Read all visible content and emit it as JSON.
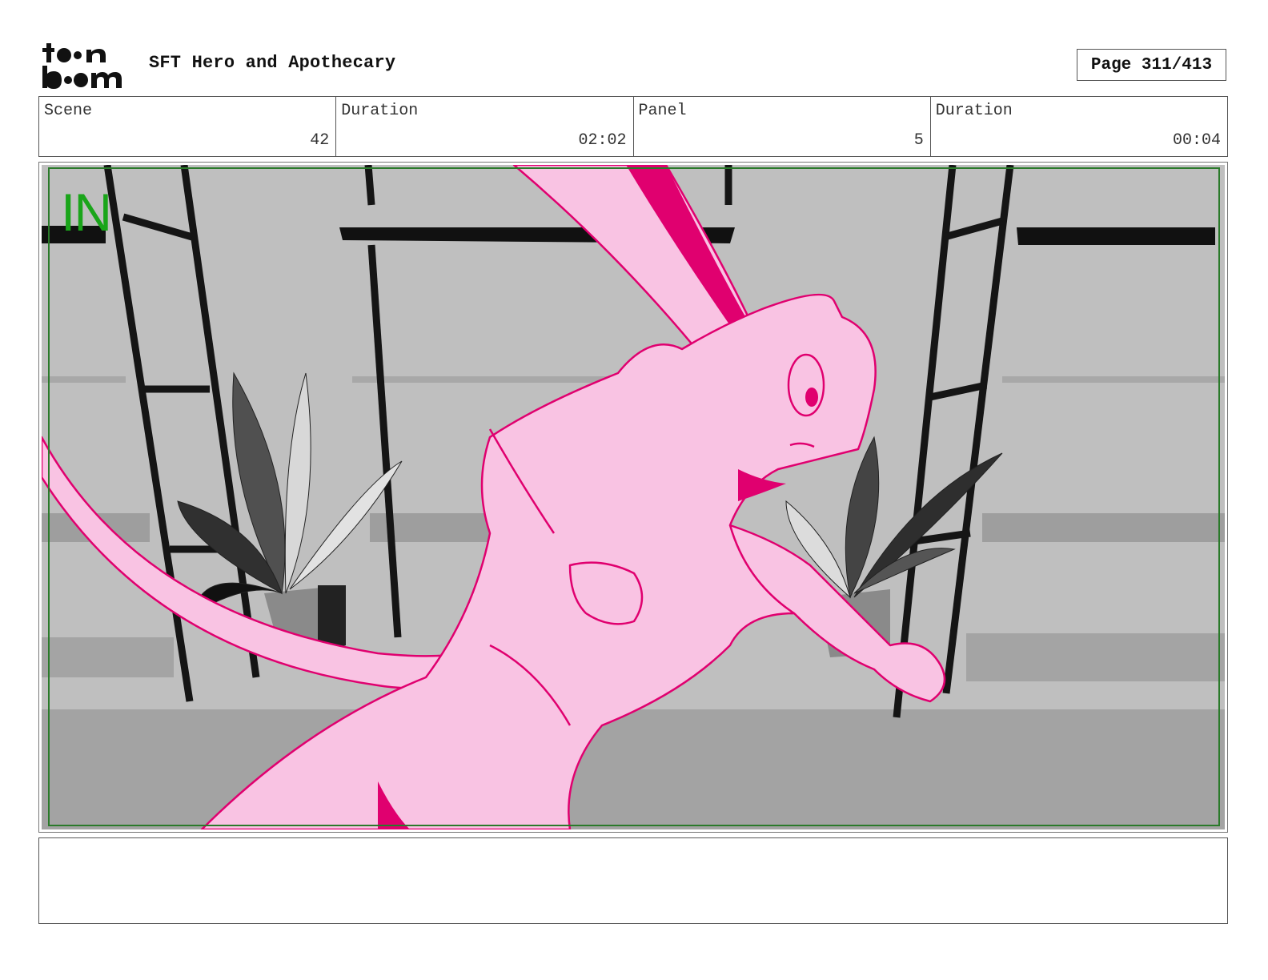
{
  "header": {
    "logo_text": "toon boom",
    "project_title": "SFT Hero and Apothecary",
    "page_label": "Page 311/413"
  },
  "info": {
    "scene_label": "Scene",
    "scene_value": "42",
    "duration_label": "Duration",
    "duration_value": "02:02",
    "panel_label": "Panel",
    "panel_value": "5",
    "panel_duration_label": "Duration",
    "panel_duration_value": "00:04"
  },
  "frame": {
    "marker": "IN",
    "marker_color": "#1aa51a",
    "safe_area_color": "#2a7a2a",
    "character_color": "#f9c3e3",
    "character_line_color": "#e0006f"
  },
  "notes": {
    "text": ""
  }
}
